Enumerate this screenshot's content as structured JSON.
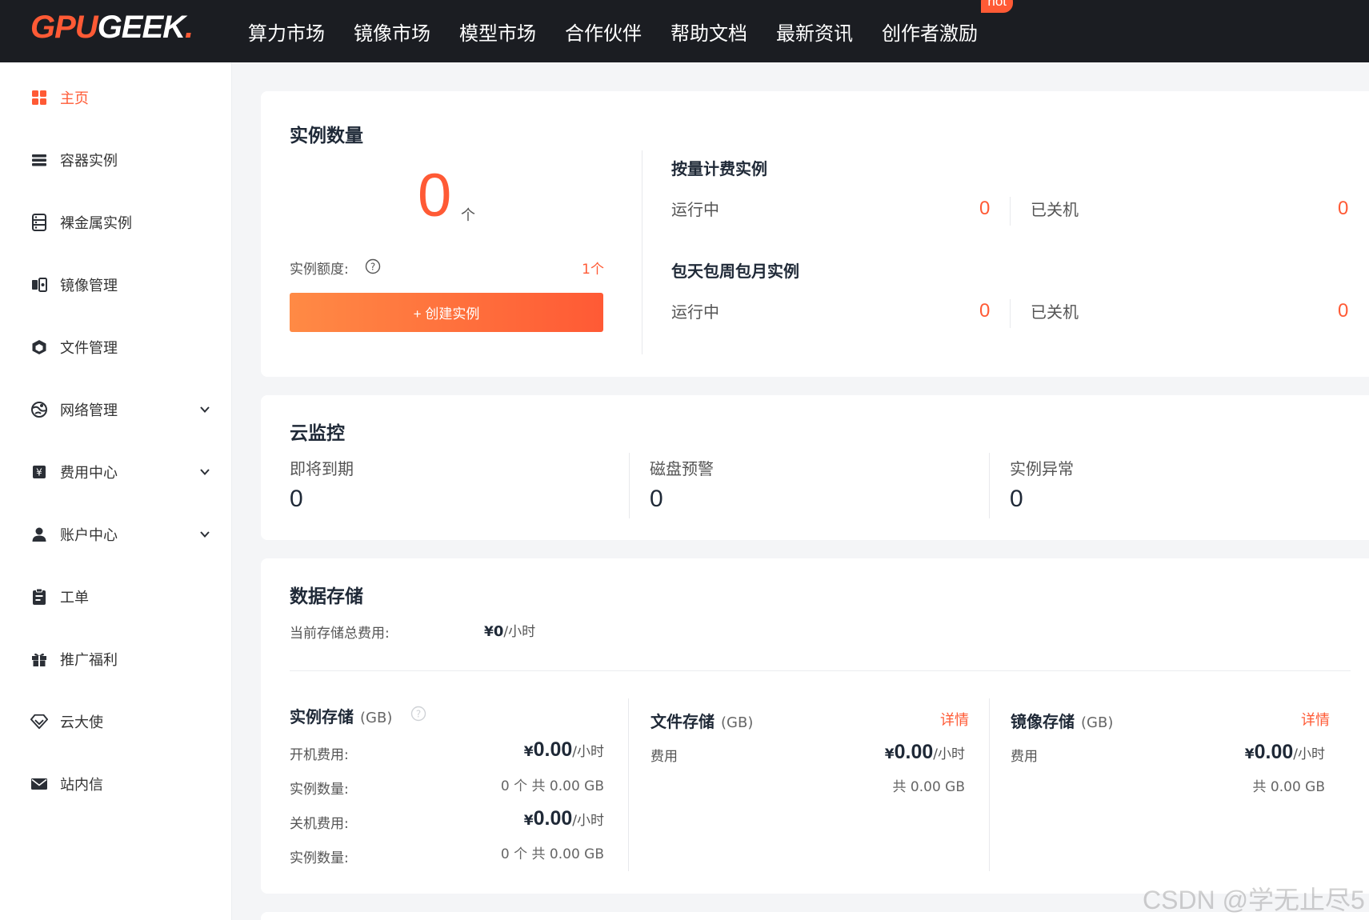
{
  "brand": {
    "logo_part1": "GPU",
    "logo_part2": "GEEK",
    "logo_part3": ".",
    "accent": "#ff5a35"
  },
  "nav": {
    "items": [
      "算力市场",
      "镜像市场",
      "模型市场",
      "合作伙伴",
      "帮助文档",
      "最新资讯",
      "创作者激励"
    ],
    "hot_badge": "hot"
  },
  "sidebar": {
    "items": [
      {
        "label": "主页",
        "icon": "dashboard-grid-icon",
        "active": true
      },
      {
        "label": "容器实例",
        "icon": "list-icon"
      },
      {
        "label": "裸金属实例",
        "icon": "server-icon"
      },
      {
        "label": "镜像管理",
        "icon": "image-icon"
      },
      {
        "label": "文件管理",
        "icon": "box-icon"
      },
      {
        "label": "网络管理",
        "icon": "globe-icon",
        "expandable": true
      },
      {
        "label": "费用中心",
        "icon": "yen-icon",
        "expandable": true
      },
      {
        "label": "账户中心",
        "icon": "user-icon",
        "expandable": true
      },
      {
        "label": "工单",
        "icon": "clipboard-icon"
      },
      {
        "label": "推广福利",
        "icon": "gift-icon"
      },
      {
        "label": "云大使",
        "icon": "diamond-icon"
      },
      {
        "label": "站内信",
        "icon": "mail-icon"
      }
    ]
  },
  "instances": {
    "title": "实例数量",
    "count": "0",
    "unit": "个",
    "quota_label": "实例额度:",
    "quota_value": "1个",
    "create_button": "+ 创建实例",
    "payg": {
      "title": "按量计费实例",
      "running_label": "运行中",
      "running_value": "0",
      "stopped_label": "已关机",
      "stopped_value": "0"
    },
    "subscription": {
      "title": "包天包周包月实例",
      "running_label": "运行中",
      "running_value": "0",
      "stopped_label": "已关机",
      "stopped_value": "0"
    }
  },
  "monitor": {
    "title": "云监控",
    "items": [
      {
        "label": "即将到期",
        "value": "0"
      },
      {
        "label": "磁盘预警",
        "value": "0"
      },
      {
        "label": "实例异常",
        "value": "0"
      }
    ]
  },
  "storage": {
    "title": "数据存储",
    "total_label": "当前存储总费用:",
    "total_yen": "¥",
    "total_value": "0",
    "total_per": "/小时",
    "instance_storage": {
      "title": "实例存储",
      "unit": "(GB)",
      "on_fee_label": "开机费用:",
      "on_fee_value": "0.00",
      "on_count_label": "实例数量:",
      "on_count_value": "0 个 共 0.00 GB",
      "off_fee_label": "关机费用:",
      "off_fee_value": "0.00",
      "off_count_label": "实例数量:",
      "off_count_value": "0 个 共 0.00 GB"
    },
    "file_storage": {
      "title": "文件存储",
      "unit": "(GB)",
      "detail": "详情",
      "fee_label": "费用",
      "fee_value": "0.00",
      "size": "共 0.00 GB"
    },
    "image_storage": {
      "title": "镜像存储",
      "unit": "(GB)",
      "detail": "详情",
      "fee_label": "费用",
      "fee_value": "0.00",
      "size": "共 0.00 GB"
    },
    "yen": "¥",
    "per_hour": "/小时"
  },
  "watermark": "CSDN @学无止尽5"
}
